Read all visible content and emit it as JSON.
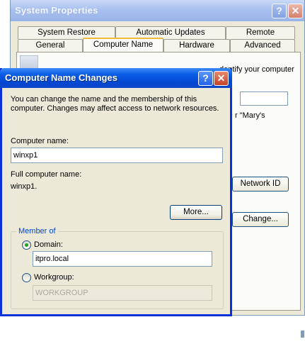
{
  "background_window": {
    "title": "System Properties",
    "tabs_row1": [
      "System Restore",
      "Automatic Updates",
      "Remote"
    ],
    "tabs_row2": [
      "General",
      "Computer Name",
      "Hardware",
      "Advanced"
    ],
    "active_tab": "Computer Name",
    "partial_text_1": "dentify your computer",
    "partial_text_2": "r \"Mary's",
    "network_id_label": "Network ID",
    "change_label": "Change..."
  },
  "dialog": {
    "title": "Computer Name Changes",
    "description": "You can change the name and the membership of this computer. Changes may affect access to network resources.",
    "computer_name_label": "Computer name:",
    "computer_name_value": "winxp1",
    "full_name_label": "Full computer name:",
    "full_name_value": "winxp1.",
    "more_label": "More...",
    "member_of_label": "Member of",
    "domain_label": "Domain:",
    "domain_value": "itpro.local",
    "workgroup_label": "Workgroup:",
    "workgroup_value": "WORKGROUP",
    "selected_membership": "Domain"
  },
  "icons": [
    "question-mark-icon",
    "close-icon",
    "computer-icon",
    "radio-selected-icon",
    "radio-unselected-icon"
  ],
  "colors": {
    "title_bar_active": "#0548d4",
    "title_bar_inactive": "#a8c0ee",
    "dialog_face": "#ece9d8",
    "groupbox_label": "#0046d5",
    "radio_dot": "#21a121"
  }
}
